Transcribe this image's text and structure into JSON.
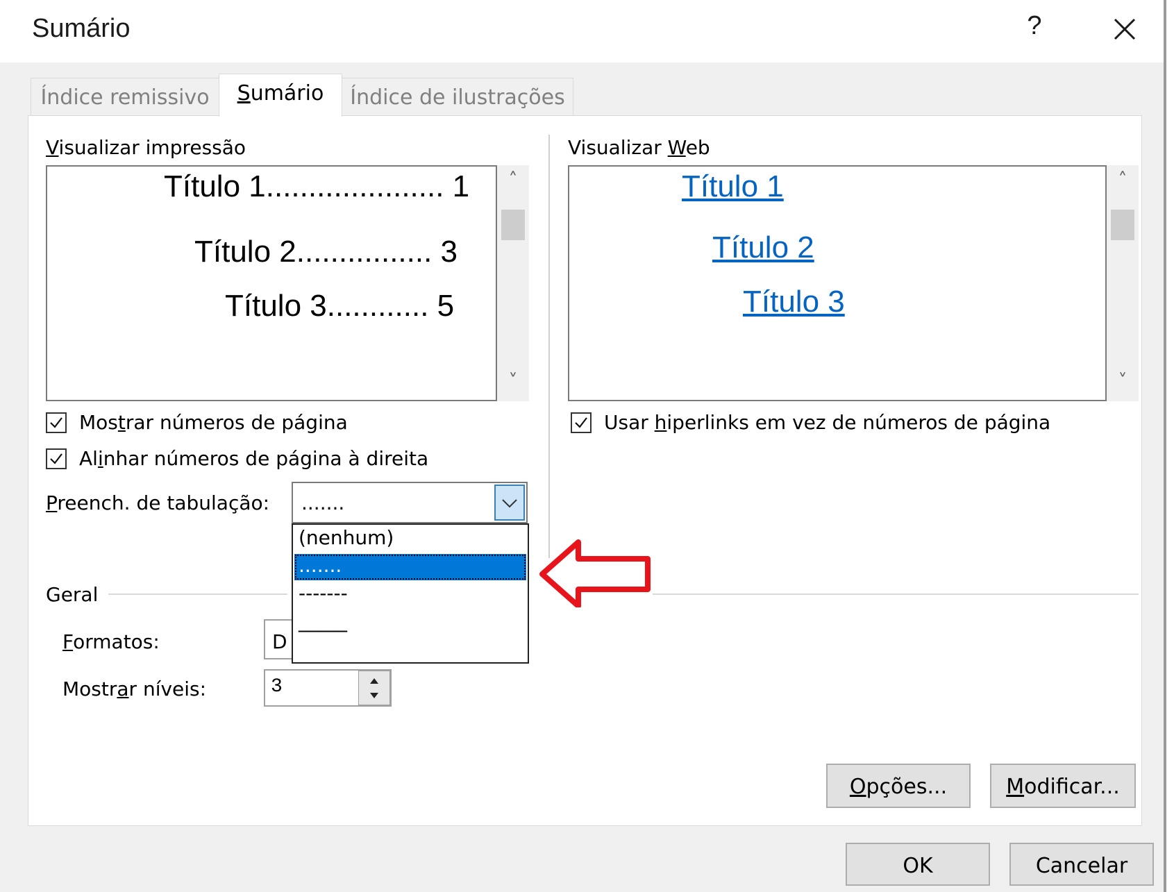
{
  "window": {
    "title": "Sumário",
    "help_label": "?",
    "close_icon": "close-icon"
  },
  "tabs": [
    {
      "label_pre": "Índice remissivo",
      "label_u": "",
      "label_post": ""
    },
    {
      "label_pre": "",
      "label_u": "S",
      "label_post": "umário"
    },
    {
      "label_pre": "Índice de ilustrações",
      "label_u": "",
      "label_post": ""
    }
  ],
  "print_preview": {
    "label_u": "V",
    "label_rest": "isualizar impressão",
    "entries": [
      "Título 1..................... 1",
      "Título 2................ 3",
      "Título 3............ 5"
    ]
  },
  "web_preview": {
    "label_pre": "Visualizar ",
    "label_u": "W",
    "label_rest": "eb",
    "entries": [
      "Título 1",
      "Título 2",
      "Título 3"
    ]
  },
  "options": {
    "show_page_numbers": {
      "pre": "Mos",
      "u": "t",
      "post": "rar números de página",
      "checked": true
    },
    "align_right": {
      "pre": "Al",
      "u": "i",
      "post": "nhar números de página à direita",
      "checked": true
    },
    "use_hyperlinks": {
      "pre": "Usar ",
      "u": "h",
      "post": "iperlinks em vez de números de página",
      "checked": true
    }
  },
  "tab_leader": {
    "label_u": "P",
    "label_rest": "reench. de tabulação:",
    "value": ".......",
    "options": [
      "(nenhum)",
      ".......",
      "-------",
      "_____"
    ],
    "selected_index": 1
  },
  "general": {
    "group_label": "Geral",
    "formats_label_u": "F",
    "formats_label_rest": "ormatos:",
    "formats_value": "D",
    "levels_label_pre": "Mostr",
    "levels_label_u": "a",
    "levels_label_post": "r níveis:",
    "levels_value": "3"
  },
  "buttons": {
    "options_u": "O",
    "options_rest": "pções...",
    "modify_u": "M",
    "modify_rest": "odificar...",
    "ok": "OK",
    "cancel": "Cancelar"
  },
  "colors": {
    "hyperlink": "#0563c1",
    "selection": "#0078d7",
    "annotation_arrow": "#e8141b"
  }
}
